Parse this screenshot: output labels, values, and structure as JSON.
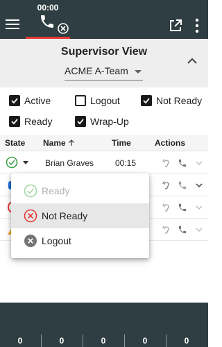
{
  "topbar": {
    "call_timer": "00:00",
    "icons": [
      "menu-icon",
      "phone-icon",
      "close-circle-icon",
      "open-external-icon",
      "more-vert-icon"
    ]
  },
  "supervisor": {
    "title": "Supervisor View",
    "team_selected": "ACME A-Team",
    "icons": [
      "dropdown-caret-icon",
      "chevron-up-icon"
    ]
  },
  "filters": [
    {
      "label": "Active",
      "checked": true
    },
    {
      "label": "Logout",
      "checked": false
    },
    {
      "label": "Not Ready",
      "checked": true
    },
    {
      "label": "Ready",
      "checked": true
    },
    {
      "label": "Wrap-Up",
      "checked": true
    }
  ],
  "table": {
    "headers": {
      "state": "State",
      "name": "Name",
      "time": "Time",
      "actions": "Actions"
    },
    "sort_icon": "arrow-up-icon",
    "rows": [
      {
        "state": "ready",
        "name": "Brian Graves",
        "time": "00:15",
        "expanded": false
      },
      {
        "state": "active",
        "name": "",
        "time": "",
        "expanded": true
      },
      {
        "state": "not-ready",
        "name": "",
        "time": "",
        "expanded": false
      },
      {
        "state": "wrap-up",
        "name": "",
        "time": "",
        "expanded": false
      }
    ],
    "action_icons": [
      "listen-icon",
      "phone-icon",
      "chevron-down-icon"
    ]
  },
  "state_menu": {
    "items": [
      {
        "label": "Ready",
        "icon": "check-circle-icon",
        "disabled": true
      },
      {
        "label": "Not Ready",
        "icon": "x-circle-icon",
        "disabled": false,
        "highlighted": true
      },
      {
        "label": "Logout",
        "icon": "x-filled-circle-icon",
        "disabled": false
      }
    ]
  },
  "bottom_stats": [
    "0",
    "0",
    "0",
    "0",
    "0"
  ],
  "colors": {
    "bar_bg": "#2f3e42",
    "accent_red": "#e53935",
    "ready_green": "#43a047",
    "active_blue": "#1e6fd9",
    "not_ready_red": "#e53935",
    "wrap_up_orange": "#f5a623"
  }
}
